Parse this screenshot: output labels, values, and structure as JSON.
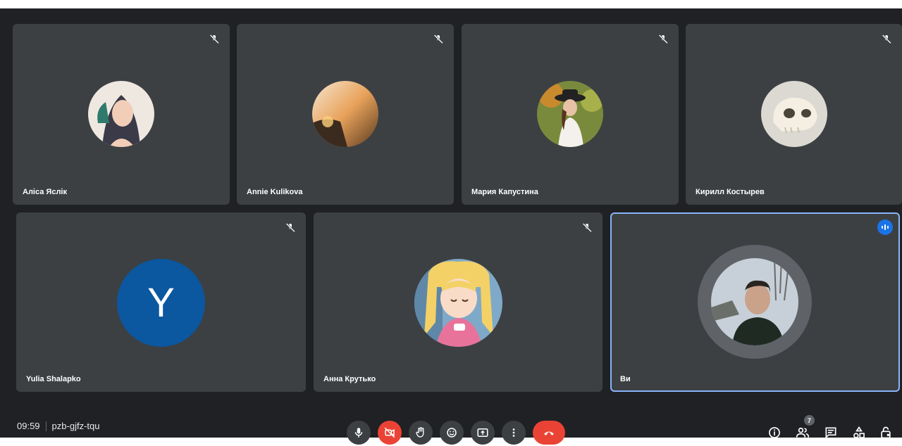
{
  "participants": [
    {
      "name": "Аліса Яслік",
      "muted": true,
      "avatar": "photo-illustrated-woman"
    },
    {
      "name": "Annie Kulikova",
      "muted": true,
      "avatar": "photo-sunset-cliff"
    },
    {
      "name": "Мария Капустина",
      "muted": true,
      "avatar": "photo-woman-hat"
    },
    {
      "name": "Кирилл Костырев",
      "muted": true,
      "avatar": "photo-skull"
    },
    {
      "name": "Yulia Shalapko",
      "muted": true,
      "avatar": "initial",
      "initial": "Y",
      "initial_color": "#0b57a0"
    },
    {
      "name": "Анна Крутько",
      "muted": true,
      "avatar": "photo-anime-girl"
    },
    {
      "name": "Ви",
      "muted": false,
      "speaking": true,
      "avatar": "photo-man-outdoors"
    }
  ],
  "footer": {
    "time": "09:59",
    "meeting_code": "pzb-gjfz-tqu",
    "people_count": "7"
  },
  "colors": {
    "background": "#202124",
    "tile": "#3c4043",
    "active_outline": "#8ab4f8",
    "danger": "#ea4335",
    "accent": "#1a73e8"
  },
  "controls": [
    "microphone-icon",
    "camera-off-icon",
    "raise-hand-icon",
    "emoji-icon",
    "present-icon",
    "more-options-icon",
    "end-call-icon"
  ],
  "right_controls": [
    "info-icon",
    "people-icon",
    "chat-icon",
    "activities-icon",
    "host-controls-icon"
  ]
}
